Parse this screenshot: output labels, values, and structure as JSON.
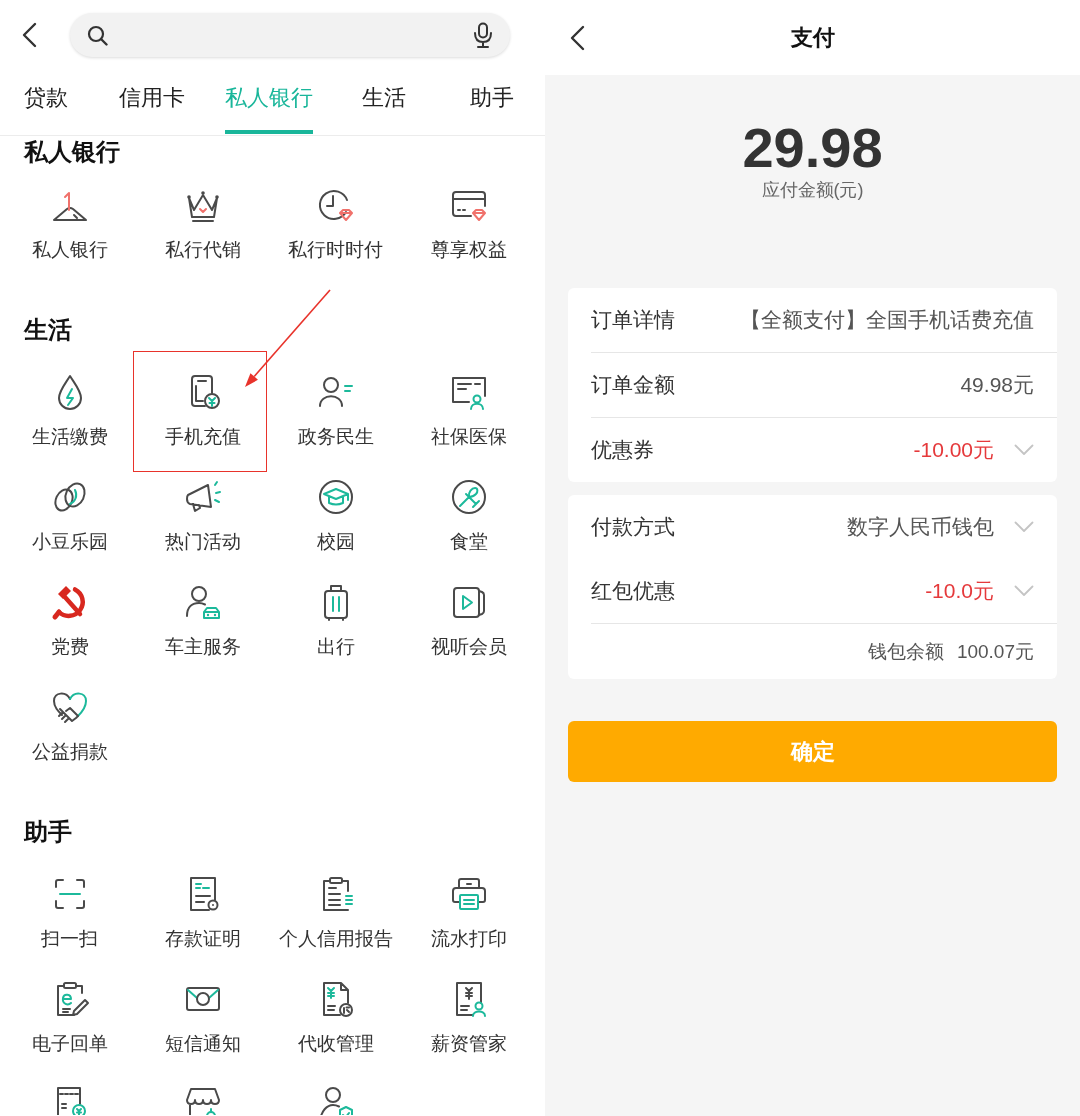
{
  "left_screen": {
    "tabs": [
      {
        "label": "贷款",
        "selected": false
      },
      {
        "label": "信用卡",
        "selected": false
      },
      {
        "label": "私人银行",
        "selected": true
      },
      {
        "label": "生活",
        "selected": false
      },
      {
        "label": "助手",
        "selected": false
      }
    ],
    "sections": [
      {
        "title": "私人银行",
        "items": [
          {
            "label": "私人银行",
            "highlighted": false
          },
          {
            "label": "私行代销",
            "highlighted": false
          },
          {
            "label": "私行时时付",
            "highlighted": false
          },
          {
            "label": "尊享权益",
            "highlighted": false
          }
        ]
      },
      {
        "title": "生活",
        "items": [
          {
            "label": "生活缴费",
            "highlighted": false
          },
          {
            "label": "手机充值",
            "highlighted": true
          },
          {
            "label": "政务民生",
            "highlighted": false
          },
          {
            "label": "社保医保",
            "highlighted": false
          },
          {
            "label": "小豆乐园",
            "highlighted": false
          },
          {
            "label": "热门活动",
            "highlighted": false
          },
          {
            "label": "校园",
            "highlighted": false
          },
          {
            "label": "食堂",
            "highlighted": false
          },
          {
            "label": "党费",
            "highlighted": false
          },
          {
            "label": "车主服务",
            "highlighted": false
          },
          {
            "label": "出行",
            "highlighted": false
          },
          {
            "label": "视听会员",
            "highlighted": false
          },
          {
            "label": "公益捐款",
            "highlighted": false
          }
        ]
      },
      {
        "title": "助手",
        "items": [
          {
            "label": "扫一扫",
            "highlighted": false
          },
          {
            "label": "存款证明",
            "highlighted": false
          },
          {
            "label": "个人信用报告",
            "highlighted": false
          },
          {
            "label": "流水打印",
            "highlighted": false
          },
          {
            "label": "电子回单",
            "highlighted": false
          },
          {
            "label": "短信通知",
            "highlighted": false
          },
          {
            "label": "代收管理",
            "highlighted": false
          },
          {
            "label": "薪资管家",
            "highlighted": false
          },
          {
            "highlighted": false
          },
          {
            "highlighted": false
          },
          {
            "highlighted": false
          }
        ]
      }
    ]
  },
  "payment_screen": {
    "title": "支付",
    "amount": "29.98",
    "amount_label": "应付金额(元)",
    "cards": [
      {
        "dividers": true,
        "rows": [
          {
            "label": "订单详情",
            "value": "【全额支付】全国手机话费充值",
            "kind": "plain",
            "dropdown": false
          },
          {
            "label": "订单金额",
            "value": "49.98元",
            "kind": "plain",
            "dropdown": false
          },
          {
            "label": "优惠券",
            "value": "-10.00元",
            "kind": "discount",
            "dropdown": true
          }
        ]
      },
      {
        "dividers": false,
        "rows": [
          {
            "label": "付款方式",
            "value": "数字人民币钱包",
            "kind": "plain",
            "dropdown": true
          },
          {
            "label": "红包优惠",
            "value": "-10.0元",
            "kind": "discount",
            "dropdown": true
          }
        ],
        "balance": {
          "label": "钱包余额",
          "value": "100.07元"
        }
      }
    ],
    "confirm_button": "确定"
  }
}
